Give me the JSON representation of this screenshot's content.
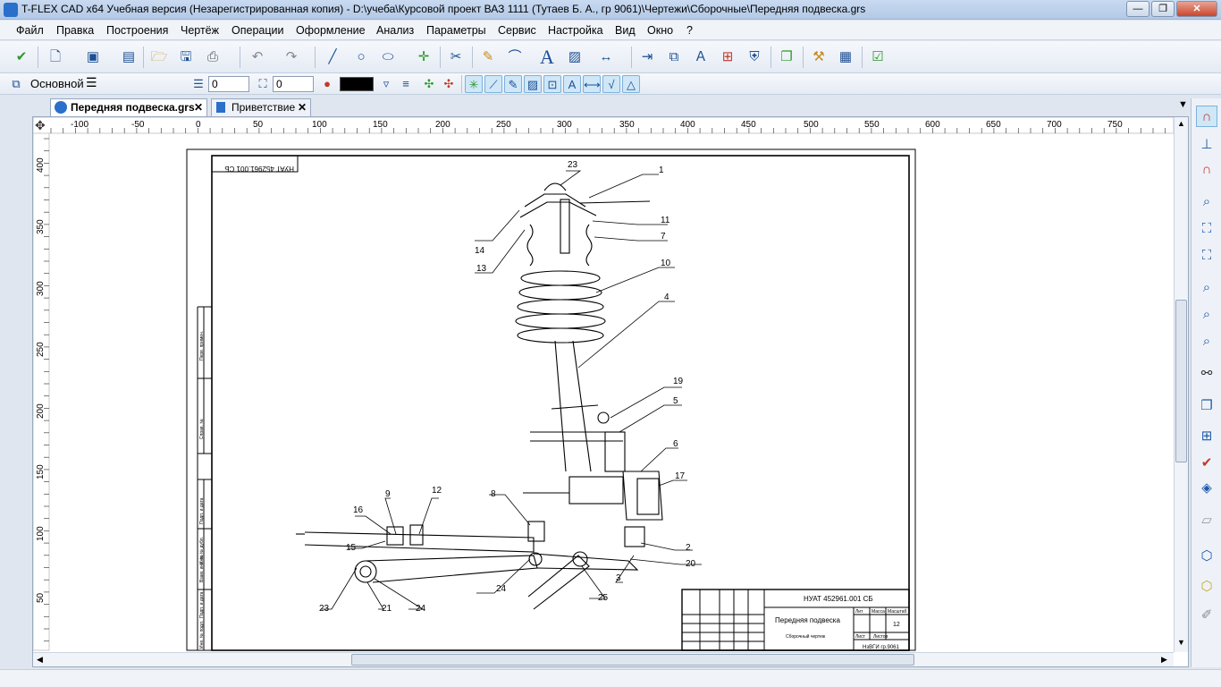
{
  "window": {
    "title": "T-FLEX CAD x64 Учебная версия (Незарегистрированная копия) - D:\\учеба\\Курсовой проект ВАЗ 1111 (Тутаев Б. А., гр 9061)\\Чертежи\\Сборочные\\Передняя подвеска.grs",
    "minimize": "—",
    "restore": "❐",
    "close": "✕"
  },
  "menu": [
    "Файл",
    "Правка",
    "Построения",
    "Чертёж",
    "Операции",
    "Оформление",
    "Анализ",
    "Параметры",
    "Сервис",
    "Настройка",
    "Вид",
    "Окно",
    "?"
  ],
  "toolbar2": {
    "layer": "Основной",
    "level_value": "0",
    "priority_value": "0"
  },
  "tabs": [
    {
      "label": "Передняя подвеска.grs",
      "active": true
    },
    {
      "label": "Приветствие",
      "active": false
    }
  ],
  "ruler": {
    "h_labels": [
      "-100",
      "-50",
      "0",
      "50",
      "100",
      "150",
      "200",
      "250",
      "300",
      "350",
      "400",
      "450",
      "500",
      "550",
      "600",
      "650",
      "700",
      "750"
    ],
    "v_labels": [
      "400",
      "350",
      "300",
      "250",
      "200",
      "150",
      "100",
      "50"
    ]
  },
  "drawing": {
    "doc_code_rotated": "НУАТ 452961.001 СБ",
    "callouts": [
      "1",
      "2",
      "3",
      "4",
      "5",
      "6",
      "7",
      "8",
      "9",
      "10",
      "11",
      "12",
      "13",
      "14",
      "15",
      "16",
      "17",
      "19",
      "20",
      "21",
      "23",
      "23",
      "24",
      "24",
      "25"
    ],
    "stamp": {
      "doc_code": "НУАТ 452961.001 СБ",
      "name": "Передняя подвеска",
      "subtitle": "Сборочный чертеж",
      "sheet": "12",
      "org": "НзВГИ гр.9061",
      "lit_label": "Лит",
      "mass_label": "Масса",
      "scale_label": "Масштаб",
      "sheet_label": "Лист",
      "sheets_label": "Листов"
    },
    "side_labels": [
      "Перв. примен.",
      "Справ. №",
      "Подп. и дата",
      "Инв. № дубл.",
      "Взам. инв. №",
      "Подп. и дата",
      "Инв. № подл."
    ]
  },
  "colors": {
    "accent": "#2a6fc9",
    "canvas": "#ffffff",
    "chrome": "#dfe6ef"
  }
}
